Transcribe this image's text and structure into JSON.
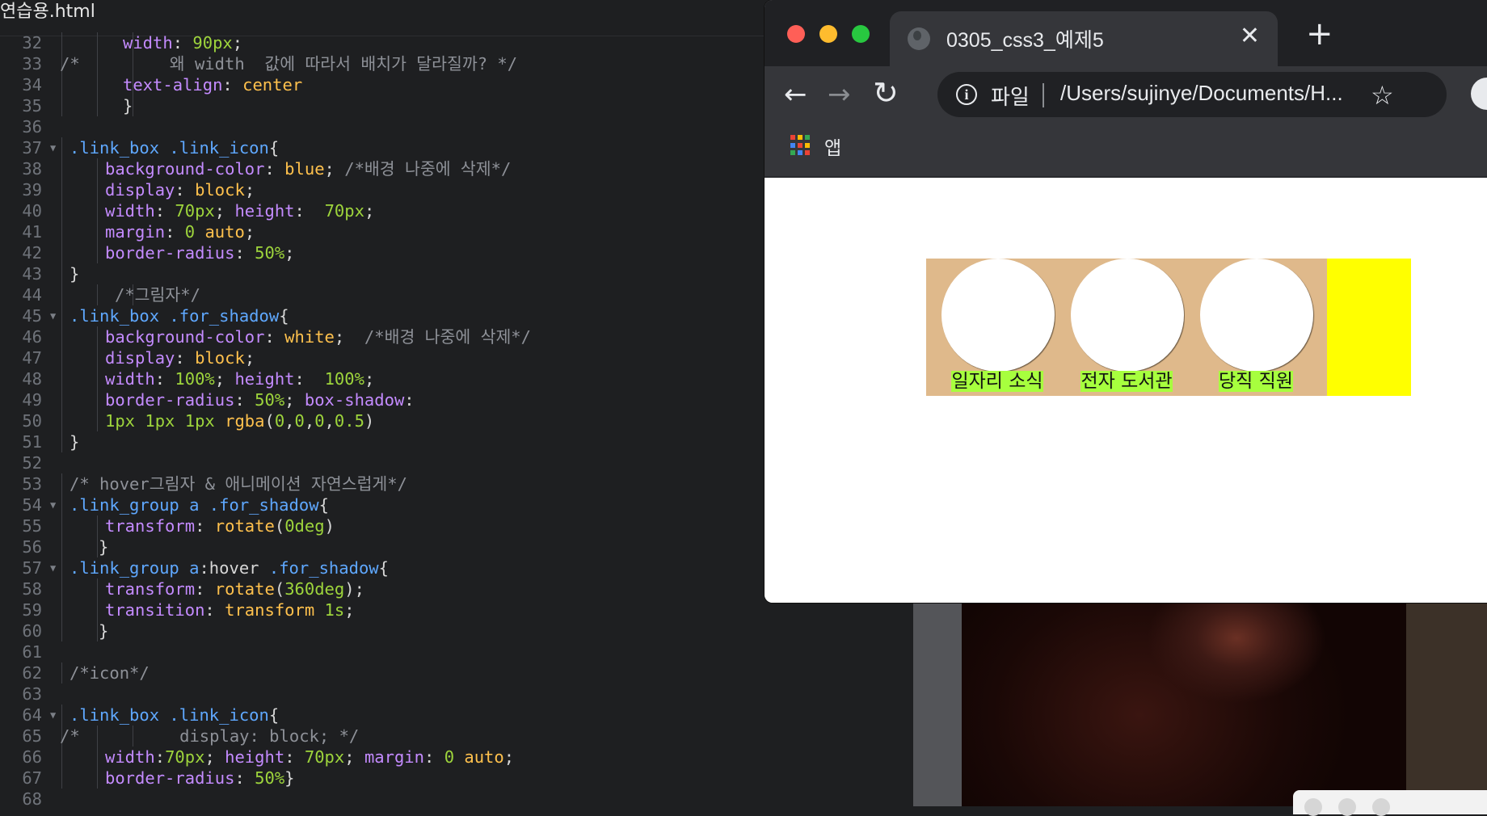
{
  "editor": {
    "filename": "연습용.html",
    "lines": [
      {
        "n": "32",
        "parts": [
          [
            "prop",
            "width"
          ],
          [
            "punct",
            ": "
          ],
          [
            "num",
            "90px"
          ],
          [
            "punct",
            ";"
          ]
        ]
      },
      {
        "n": "33",
        "parts": [
          [
            "com",
            "/*         왜 width  값에 따라서 배치가 달라질까? */"
          ]
        ]
      },
      {
        "n": "34",
        "parts": [
          [
            "prop",
            "text-align"
          ],
          [
            "punct",
            ": "
          ],
          [
            "val",
            "center"
          ]
        ]
      },
      {
        "n": "35",
        "parts": [
          [
            "punct",
            "}"
          ]
        ]
      },
      {
        "n": "36",
        "parts": []
      },
      {
        "n": "37",
        "parts": [
          [
            "sel",
            ".link_box .link_icon"
          ],
          [
            "punct",
            "{"
          ]
        ]
      },
      {
        "n": "38",
        "parts": [
          [
            "prop",
            "background-color"
          ],
          [
            "punct",
            ": "
          ],
          [
            "val",
            "blue"
          ],
          [
            "punct",
            "; "
          ],
          [
            "com",
            "/*배경 나중에 삭제*/"
          ]
        ]
      },
      {
        "n": "39",
        "parts": [
          [
            "prop",
            "display"
          ],
          [
            "punct",
            ": "
          ],
          [
            "val",
            "block"
          ],
          [
            "punct",
            ";"
          ]
        ]
      },
      {
        "n": "40",
        "parts": [
          [
            "prop",
            "width"
          ],
          [
            "punct",
            ": "
          ],
          [
            "num",
            "70px"
          ],
          [
            "punct",
            "; "
          ],
          [
            "prop",
            "height"
          ],
          [
            "punct",
            ":  "
          ],
          [
            "num",
            "70px"
          ],
          [
            "punct",
            ";"
          ]
        ]
      },
      {
        "n": "41",
        "parts": [
          [
            "prop",
            "margin"
          ],
          [
            "punct",
            ": "
          ],
          [
            "num",
            "0"
          ],
          [
            "punct",
            " "
          ],
          [
            "val",
            "auto"
          ],
          [
            "punct",
            ";"
          ]
        ]
      },
      {
        "n": "42",
        "parts": [
          [
            "prop",
            "border-radius"
          ],
          [
            "punct",
            ": "
          ],
          [
            "num",
            "50%"
          ],
          [
            "punct",
            ";"
          ]
        ]
      },
      {
        "n": "43",
        "parts": [
          [
            "punct",
            "}"
          ]
        ]
      },
      {
        "n": "44",
        "parts": [
          [
            "com",
            "/*그림자*/"
          ]
        ]
      },
      {
        "n": "45",
        "parts": [
          [
            "sel",
            ".link_box .for_shadow"
          ],
          [
            "punct",
            "{"
          ]
        ]
      },
      {
        "n": "46",
        "parts": [
          [
            "prop",
            "background-color"
          ],
          [
            "punct",
            ": "
          ],
          [
            "val",
            "white"
          ],
          [
            "punct",
            ";  "
          ],
          [
            "com",
            "/*배경 나중에 삭제*/"
          ]
        ]
      },
      {
        "n": "47",
        "parts": [
          [
            "prop",
            "display"
          ],
          [
            "punct",
            ": "
          ],
          [
            "val",
            "block"
          ],
          [
            "punct",
            ";"
          ]
        ]
      },
      {
        "n": "48",
        "parts": [
          [
            "prop",
            "width"
          ],
          [
            "punct",
            ": "
          ],
          [
            "num",
            "100%"
          ],
          [
            "punct",
            "; "
          ],
          [
            "prop",
            "height"
          ],
          [
            "punct",
            ":  "
          ],
          [
            "num",
            "100%"
          ],
          [
            "punct",
            ";"
          ]
        ]
      },
      {
        "n": "49",
        "parts": [
          [
            "prop",
            "border-radius"
          ],
          [
            "punct",
            ": "
          ],
          [
            "num",
            "50%"
          ],
          [
            "punct",
            "; "
          ],
          [
            "prop",
            "box-shadow"
          ],
          [
            "punct",
            ":"
          ]
        ]
      },
      {
        "n": "50",
        "parts": [
          [
            "num",
            "1px 1px 1px "
          ],
          [
            "val",
            "rgba"
          ],
          [
            "punct",
            "("
          ],
          [
            "num",
            "0"
          ],
          [
            "punct",
            ","
          ],
          [
            "num",
            "0"
          ],
          [
            "punct",
            ","
          ],
          [
            "num",
            "0"
          ],
          [
            "punct",
            ","
          ],
          [
            "num",
            "0.5"
          ],
          [
            "punct",
            ")"
          ]
        ]
      },
      {
        "n": "51",
        "parts": [
          [
            "punct",
            "}"
          ]
        ]
      },
      {
        "n": "52",
        "parts": []
      },
      {
        "n": "53",
        "parts": [
          [
            "com",
            "/* hover그림자 & 애니메이션 자연스럽게*/"
          ]
        ]
      },
      {
        "n": "54",
        "parts": [
          [
            "sel",
            ".link_group a .for_shadow"
          ],
          [
            "punct",
            "{"
          ]
        ]
      },
      {
        "n": "55",
        "parts": [
          [
            "prop",
            "transform"
          ],
          [
            "punct",
            ": "
          ],
          [
            "val",
            "rotate"
          ],
          [
            "punct",
            "("
          ],
          [
            "num",
            "0deg"
          ],
          [
            "punct",
            ")"
          ]
        ]
      },
      {
        "n": "56",
        "parts": [
          [
            "punct",
            "}"
          ]
        ]
      },
      {
        "n": "57",
        "parts": [
          [
            "sel",
            ".link_group a"
          ],
          [
            "hov",
            ":hover "
          ],
          [
            "sel",
            ".for_shadow"
          ],
          [
            "punct",
            "{"
          ]
        ]
      },
      {
        "n": "58",
        "parts": [
          [
            "prop",
            "transform"
          ],
          [
            "punct",
            ": "
          ],
          [
            "val",
            "rotate"
          ],
          [
            "punct",
            "("
          ],
          [
            "num",
            "360deg"
          ],
          [
            "punct",
            ");"
          ]
        ]
      },
      {
        "n": "59",
        "parts": [
          [
            "prop",
            "transition"
          ],
          [
            "punct",
            ": "
          ],
          [
            "val",
            "transform"
          ],
          [
            "punct",
            " "
          ],
          [
            "num",
            "1s"
          ],
          [
            "punct",
            ";"
          ]
        ]
      },
      {
        "n": "60",
        "parts": [
          [
            "punct",
            "}"
          ]
        ]
      },
      {
        "n": "61",
        "parts": []
      },
      {
        "n": "62",
        "parts": [
          [
            "com",
            "/*icon*/"
          ]
        ]
      },
      {
        "n": "63",
        "parts": []
      },
      {
        "n": "64",
        "parts": [
          [
            "sel",
            ".link_box .link_icon"
          ],
          [
            "punct",
            "{"
          ]
        ]
      },
      {
        "n": "65",
        "parts": [
          [
            "com",
            "/*          display: block; */"
          ]
        ]
      },
      {
        "n": "66",
        "parts": [
          [
            "prop",
            "width"
          ],
          [
            "punct",
            ":"
          ],
          [
            "num",
            "70px"
          ],
          [
            "punct",
            "; "
          ],
          [
            "prop",
            "height"
          ],
          [
            "punct",
            ": "
          ],
          [
            "num",
            "70px"
          ],
          [
            "punct",
            "; "
          ],
          [
            "prop",
            "margin"
          ],
          [
            "punct",
            ": "
          ],
          [
            "num",
            "0"
          ],
          [
            "punct",
            " "
          ],
          [
            "val",
            "auto"
          ],
          [
            "punct",
            ";"
          ]
        ]
      },
      {
        "n": "67",
        "parts": [
          [
            "prop",
            "border-radius"
          ],
          [
            "punct",
            ": "
          ],
          [
            "num",
            "50%"
          ],
          [
            "punct",
            "}"
          ]
        ]
      },
      {
        "n": "68",
        "parts": []
      }
    ]
  },
  "browser": {
    "tab_title": "0305_css3_예제5",
    "tab_close": "✕",
    "new_tab": "+",
    "back": "←",
    "forward": "→",
    "reload": "↻",
    "omnibox_label": "파일",
    "url": "/Users/sujinye/Documents/H...",
    "star": "☆",
    "apps_label": "앱",
    "apps_colors": [
      "#ea4335",
      "#fbbc04",
      "#34a853",
      "#4285f4",
      "#ea4335",
      "#fbbc04",
      "#34a853",
      "#4285f4",
      "#ea4335"
    ],
    "traffic_lights": [
      "#ff5f57",
      "#febc2e",
      "#28c840"
    ]
  },
  "page": {
    "group_bg": "#ffff00",
    "box_bg": "#dfb98b",
    "label_bg": "#a7ff3e",
    "links": [
      {
        "label": "일자리 소식"
      },
      {
        "label": "전자 도서관"
      },
      {
        "label": "당직 직원"
      }
    ]
  }
}
